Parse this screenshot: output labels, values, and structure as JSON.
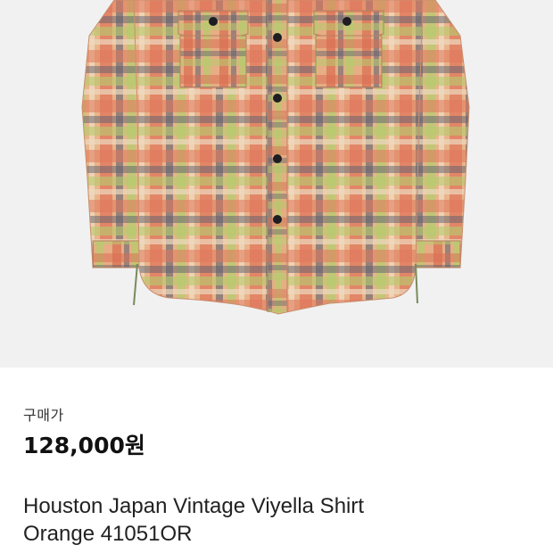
{
  "product": {
    "image_alt": "plaid shirt product photo",
    "price_label": "구매가",
    "price": "128,000원",
    "name_line1": "Houston Japan Vintage Viyella Shirt",
    "name_line2": "Orange 41051OR"
  },
  "colors": {
    "photo_background": "#f1f1f1",
    "text": "#222222"
  }
}
